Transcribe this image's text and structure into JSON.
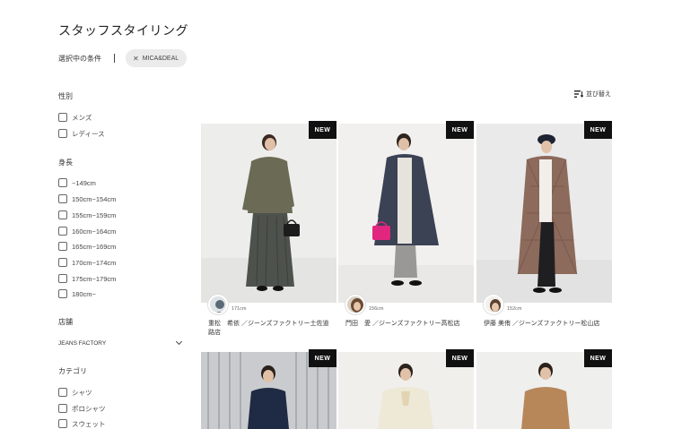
{
  "page": {
    "title": "スタッフスタイリング"
  },
  "conditions": {
    "label": "選択中の条件",
    "chip": "MICA&DEAL"
  },
  "sort": {
    "label": "並び替え"
  },
  "filters": {
    "gender": {
      "title": "性別",
      "options": [
        "メンズ",
        "レディース"
      ]
    },
    "height": {
      "title": "身長",
      "options": [
        "~149cm",
        "150cm~154cm",
        "155cm~159cm",
        "160cm~164cm",
        "165cm~169cm",
        "170cm~174cm",
        "175cm~179cm",
        "180cm~"
      ]
    },
    "store": {
      "title": "店舗",
      "selected": "JEANS FACTORY"
    },
    "category": {
      "title": "カテゴリ",
      "options": [
        "シャツ",
        "ポロシャツ",
        "スウェット"
      ]
    }
  },
  "cards": [
    {
      "badge": "NEW",
      "height": "171cm",
      "staff": "重松　希依 ／ジーンズファクトリー土佐道路店"
    },
    {
      "badge": "NEW",
      "height": "156cm",
      "staff": "門田　愛 ／ジーンズファクトリー高松店"
    },
    {
      "badge": "NEW",
      "height": "152cm",
      "staff": "伊藤 美侑 ／ジーンズファクトリー松山店"
    },
    {
      "badge": "NEW"
    },
    {
      "badge": "NEW"
    },
    {
      "badge": "NEW"
    }
  ]
}
